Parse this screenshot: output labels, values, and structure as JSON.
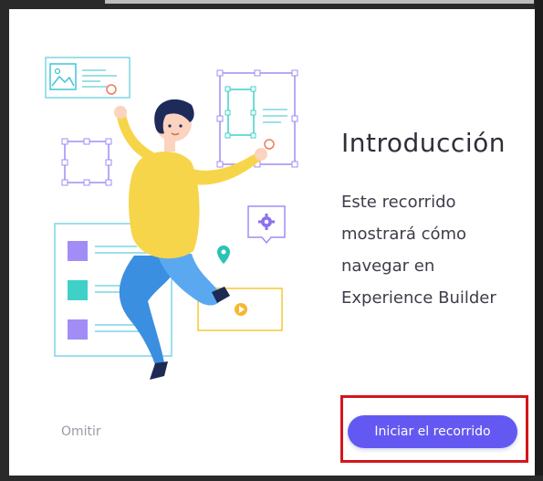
{
  "dialog": {
    "title": "Introducción",
    "description_lines": [
      "Este recorrido",
      "mostrará cómo",
      "navegar en",
      "Experience Builder"
    ],
    "skip_label": "Omitir",
    "start_label": "Iniciar el recorrido",
    "illustration": "tour-intro-illustration"
  },
  "colors": {
    "accent": "#6458f2",
    "highlight": "#d4151b",
    "purple_box": "#a28cf5",
    "teal": "#3fd1c8",
    "yellow": "#f5c738"
  }
}
